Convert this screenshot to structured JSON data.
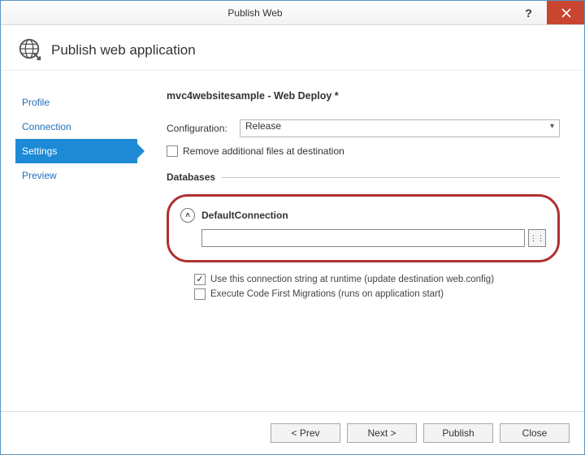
{
  "window": {
    "title": "Publish Web"
  },
  "header": {
    "title": "Publish web application"
  },
  "sidebar": {
    "items": [
      {
        "label": "Profile"
      },
      {
        "label": "Connection"
      },
      {
        "label": "Settings"
      },
      {
        "label": "Preview"
      }
    ],
    "active_index": 2
  },
  "main": {
    "title": "mvc4websitesample - Web Deploy *",
    "config_label": "Configuration:",
    "config_value": "Release",
    "remove_files_label": "Remove additional files at destination",
    "remove_files_checked": false,
    "databases_title": "Databases",
    "connection": {
      "name": "DefaultConnection",
      "value": "",
      "use_at_runtime_label": "Use this connection string at runtime (update destination web.config)",
      "use_at_runtime_checked": true,
      "code_first_label": "Execute Code First Migrations (runs on application start)",
      "code_first_checked": false
    }
  },
  "footer": {
    "prev": "< Prev",
    "next": "Next >",
    "publish": "Publish",
    "close": "Close"
  }
}
